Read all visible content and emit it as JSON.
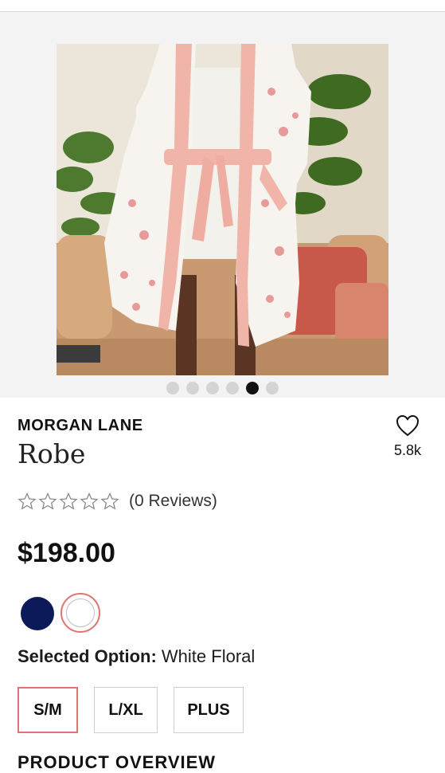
{
  "product": {
    "brand": "MORGAN LANE",
    "title": "Robe",
    "favorites_count": "5.8k",
    "reviews_text": "(0 Reviews)",
    "rating_stars": 0,
    "price": "$198.00",
    "selected_option_label": "Selected Option:",
    "selected_option_value": "White Floral"
  },
  "gallery": {
    "total_images": 6,
    "active_index": 4
  },
  "swatches": [
    {
      "name": "Navy",
      "color": "#0c1a5a",
      "selected": false
    },
    {
      "name": "White Floral",
      "color": "#ffffff",
      "selected": true
    }
  ],
  "sizes": [
    {
      "label": "S/M",
      "selected": true
    },
    {
      "label": "L/XL",
      "selected": false
    },
    {
      "label": "PLUS",
      "selected": false
    }
  ],
  "section": {
    "overview_title": "PRODUCT OVERVIEW"
  },
  "colors": {
    "accent": "#e0756e",
    "navy": "#0c1a5a"
  }
}
